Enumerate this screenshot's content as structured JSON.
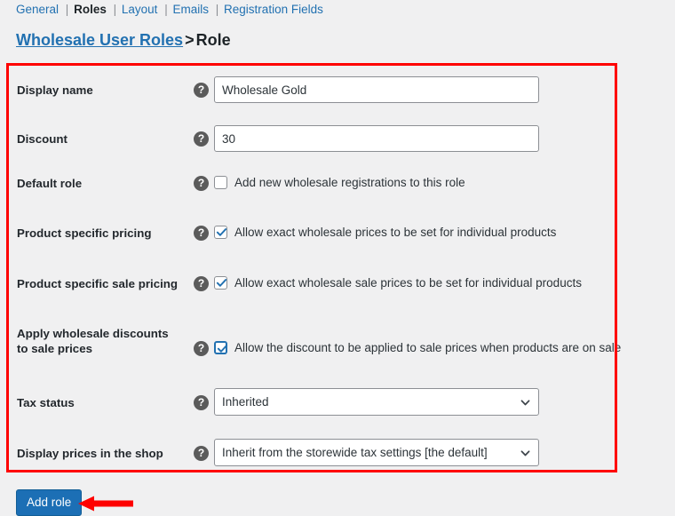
{
  "subnav": {
    "tabs": [
      {
        "label": "General",
        "active": false
      },
      {
        "label": "Roles",
        "active": true
      },
      {
        "label": "Layout",
        "active": false
      },
      {
        "label": "Emails",
        "active": false
      },
      {
        "label": "Registration Fields",
        "active": false
      }
    ],
    "separator": "|"
  },
  "breadcrumb": {
    "link": "Wholesale User Roles",
    "separator": ">",
    "current": "Role"
  },
  "form": {
    "rows": {
      "display_name": {
        "label": "Display name",
        "help": "?",
        "value": "Wholesale Gold",
        "placeholder": ""
      },
      "discount": {
        "label": "Discount",
        "help": "?",
        "value": "30",
        "placeholder": ""
      },
      "default_role": {
        "label": "Default role",
        "help": "?",
        "checkbox_label": "Add new wholesale registrations to this role",
        "checked": false
      },
      "product_specific_pricing": {
        "label": "Product specific pricing",
        "help": "?",
        "checkbox_label": "Allow exact wholesale prices to be set for individual products",
        "checked": true
      },
      "product_specific_sale_pricing": {
        "label": "Product specific sale pricing",
        "help": "?",
        "checkbox_label": "Allow exact wholesale sale prices to be set for individual products",
        "checked": true
      },
      "apply_discounts_sale": {
        "label": "Apply wholesale discounts to sale prices",
        "help": "?",
        "checkbox_label": "Allow the discount to be applied to sale prices when products are on sale",
        "checked": true,
        "focused": true
      },
      "tax_status": {
        "label": "Tax status",
        "help": "?",
        "value": "Inherited"
      },
      "display_prices": {
        "label": "Display prices in the shop",
        "help": "?",
        "value": "Inherit from the storewide tax settings [the default]"
      }
    }
  },
  "actions": {
    "add_role_label": "Add role"
  },
  "annotations": {
    "highlight_color": "#fe0000",
    "arrow_color": "#fe0000"
  },
  "colors": {
    "accent_blue": "#2271b1",
    "button_blue": "#1c6fb5",
    "page_background": "#f0f0f1",
    "label_text": "#23282d"
  }
}
